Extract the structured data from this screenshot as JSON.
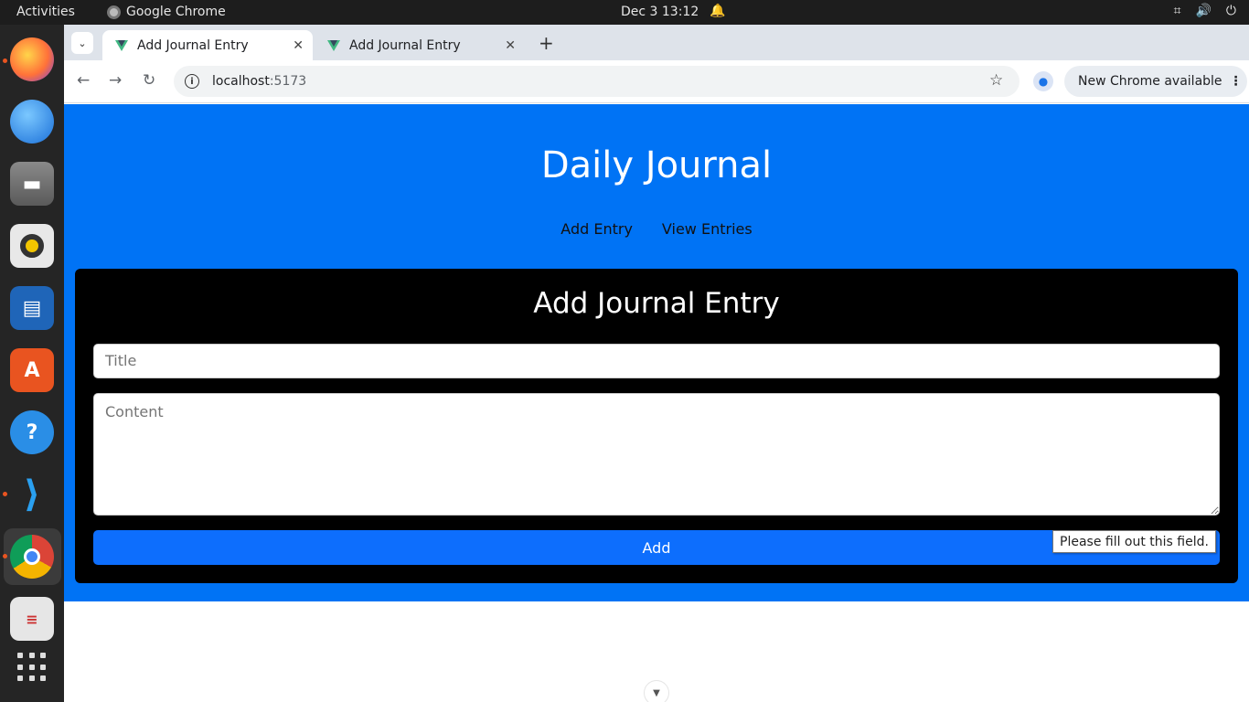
{
  "system": {
    "activities": "Activities",
    "app_name": "Google Chrome",
    "clock": "Dec 3  13:12"
  },
  "dock": {
    "items": [
      "firefox-icon",
      "thunderbird-icon",
      "files-icon",
      "rhythmbox-icon",
      "writer-icon",
      "app-center-icon",
      "help-icon",
      "vscode-icon",
      "chrome-icon",
      "text-editor-icon"
    ],
    "grid_label": "show-apps-icon"
  },
  "browser": {
    "tabs": [
      {
        "title": "Add Journal Entry",
        "active": true
      },
      {
        "title": "Add Journal Entry",
        "active": false
      }
    ],
    "url_host": "localhost",
    "url_port": ":5173",
    "update_label": "New Chrome available"
  },
  "page": {
    "app_title": "Daily Journal",
    "nav": {
      "add": "Add Entry",
      "view": "View Entries"
    },
    "form": {
      "heading": "Add Journal Entry",
      "title_placeholder": "Title",
      "content_placeholder": "Content",
      "submit_label": "Add",
      "validation_tooltip": "Please fill out this field."
    }
  },
  "colors": {
    "app_background": "#0073f5",
    "card_background": "#000000",
    "button": "#0d6efd"
  }
}
